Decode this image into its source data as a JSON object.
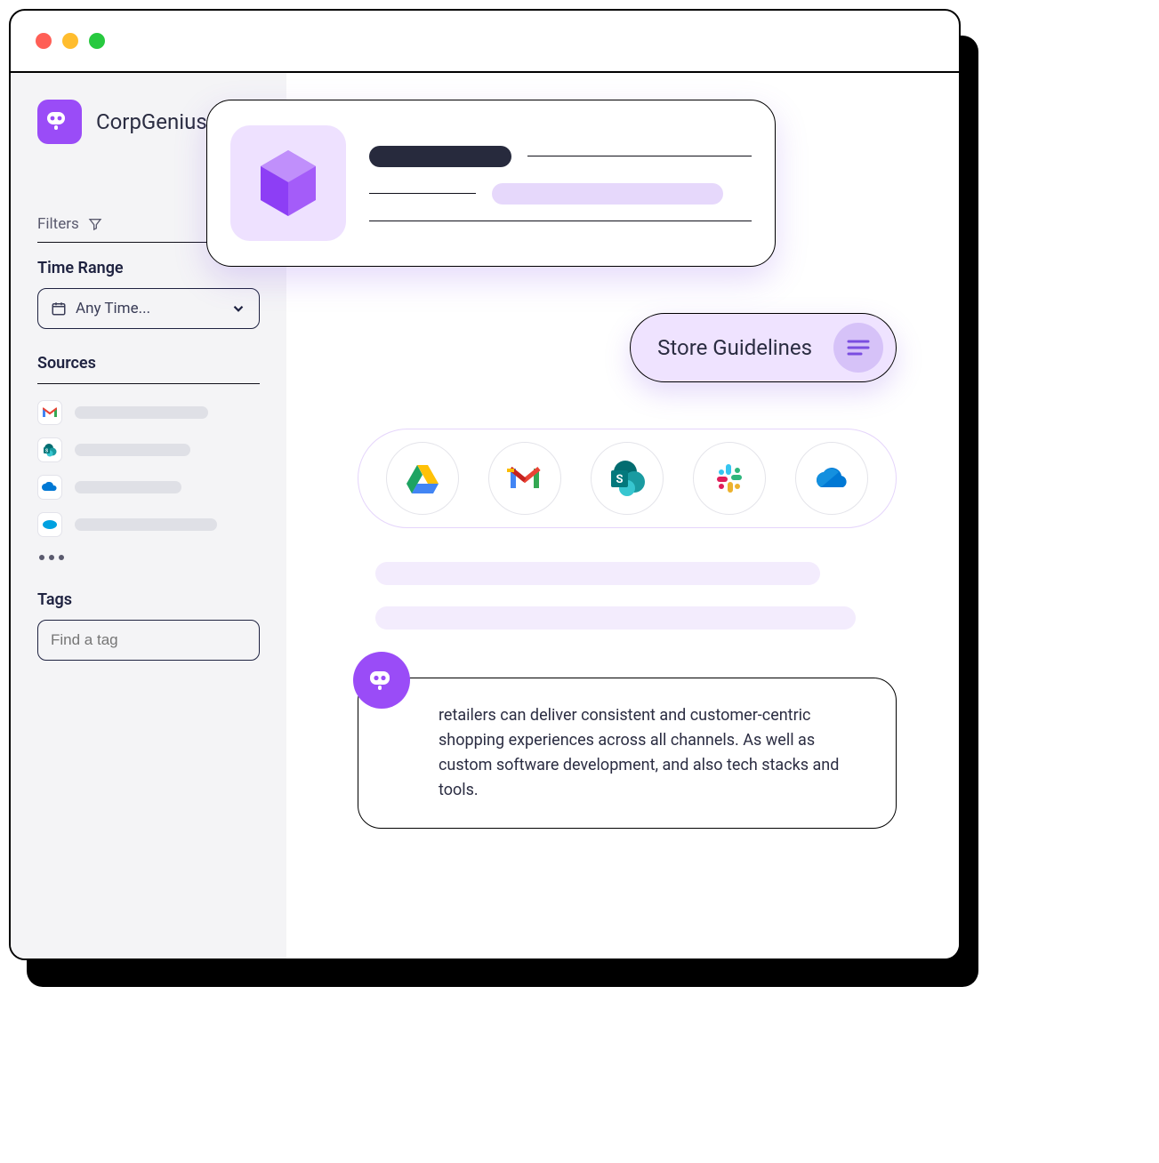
{
  "brand": {
    "name": "CorpGenius"
  },
  "sidebar": {
    "filters_label": "Filters",
    "time_range_label": "Time Range",
    "time_value": "Any Time...",
    "sources_label": "Sources",
    "source_icons": [
      "gmail",
      "sharepoint",
      "onedrive",
      "salesforce"
    ],
    "tags_label": "Tags",
    "tags_placeholder": "Find a tag"
  },
  "chip": {
    "label": "Store Guidelines"
  },
  "integrations": [
    "google-drive",
    "gmail",
    "sharepoint",
    "slack",
    "onedrive"
  ],
  "response": {
    "text": "retailers can deliver consistent and customer-centric shopping experiences across all channels. As well as custom software development, and also tech stacks and tools."
  }
}
